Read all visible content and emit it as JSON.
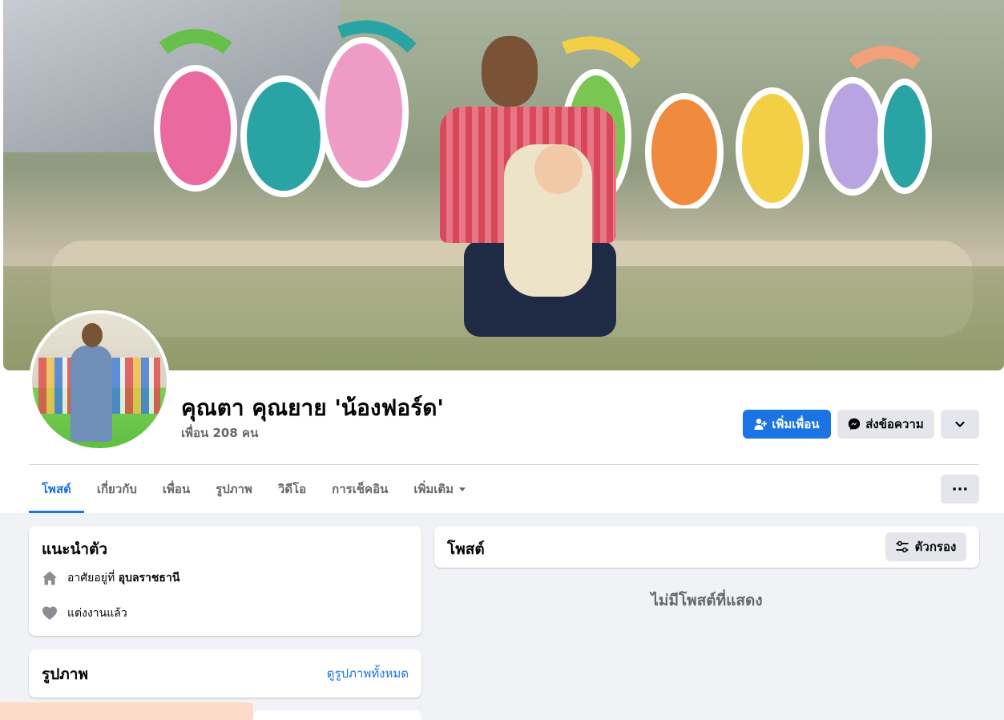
{
  "profile": {
    "name": "คุณตา คุณยาย 'น้องฟอร์ด'",
    "friends_count": "เพื่อน 208 คน"
  },
  "actions": {
    "add_friend": "เพิ่มเพื่อน",
    "message": "ส่งข้อความ"
  },
  "tabs": [
    {
      "label": "โพสต์",
      "active": true
    },
    {
      "label": "เกี่ยวกับ"
    },
    {
      "label": "เพื่อน"
    },
    {
      "label": "รูปภาพ"
    },
    {
      "label": "วิดีโอ"
    },
    {
      "label": "การเช็คอิน"
    },
    {
      "label": "เพิ่มเติม"
    }
  ],
  "more_dots": "···",
  "intro": {
    "title": "แนะนำตัว",
    "lives_prefix": "อาศัยอยู่ที่",
    "lives_place": "อุบลราชธานี",
    "relationship": "แต่งงานแล้ว"
  },
  "photos": {
    "title": "รูปภาพ",
    "see_all": "ดูรูปภาพทั้งหมด"
  },
  "posts": {
    "title": "โพสต์",
    "filter": "ตัวกรอง",
    "empty": "ไม่มีโพสต์ที่แสดง"
  },
  "colors": {
    "accent": "#1b74e4",
    "background": "#f0f2f5",
    "secondary_text": "#65676b"
  },
  "icons": [
    "add-friend-icon",
    "messenger-icon",
    "chevron-down-icon",
    "home-icon",
    "heart-icon",
    "filter-icon",
    "dropdown-caret-icon"
  ]
}
